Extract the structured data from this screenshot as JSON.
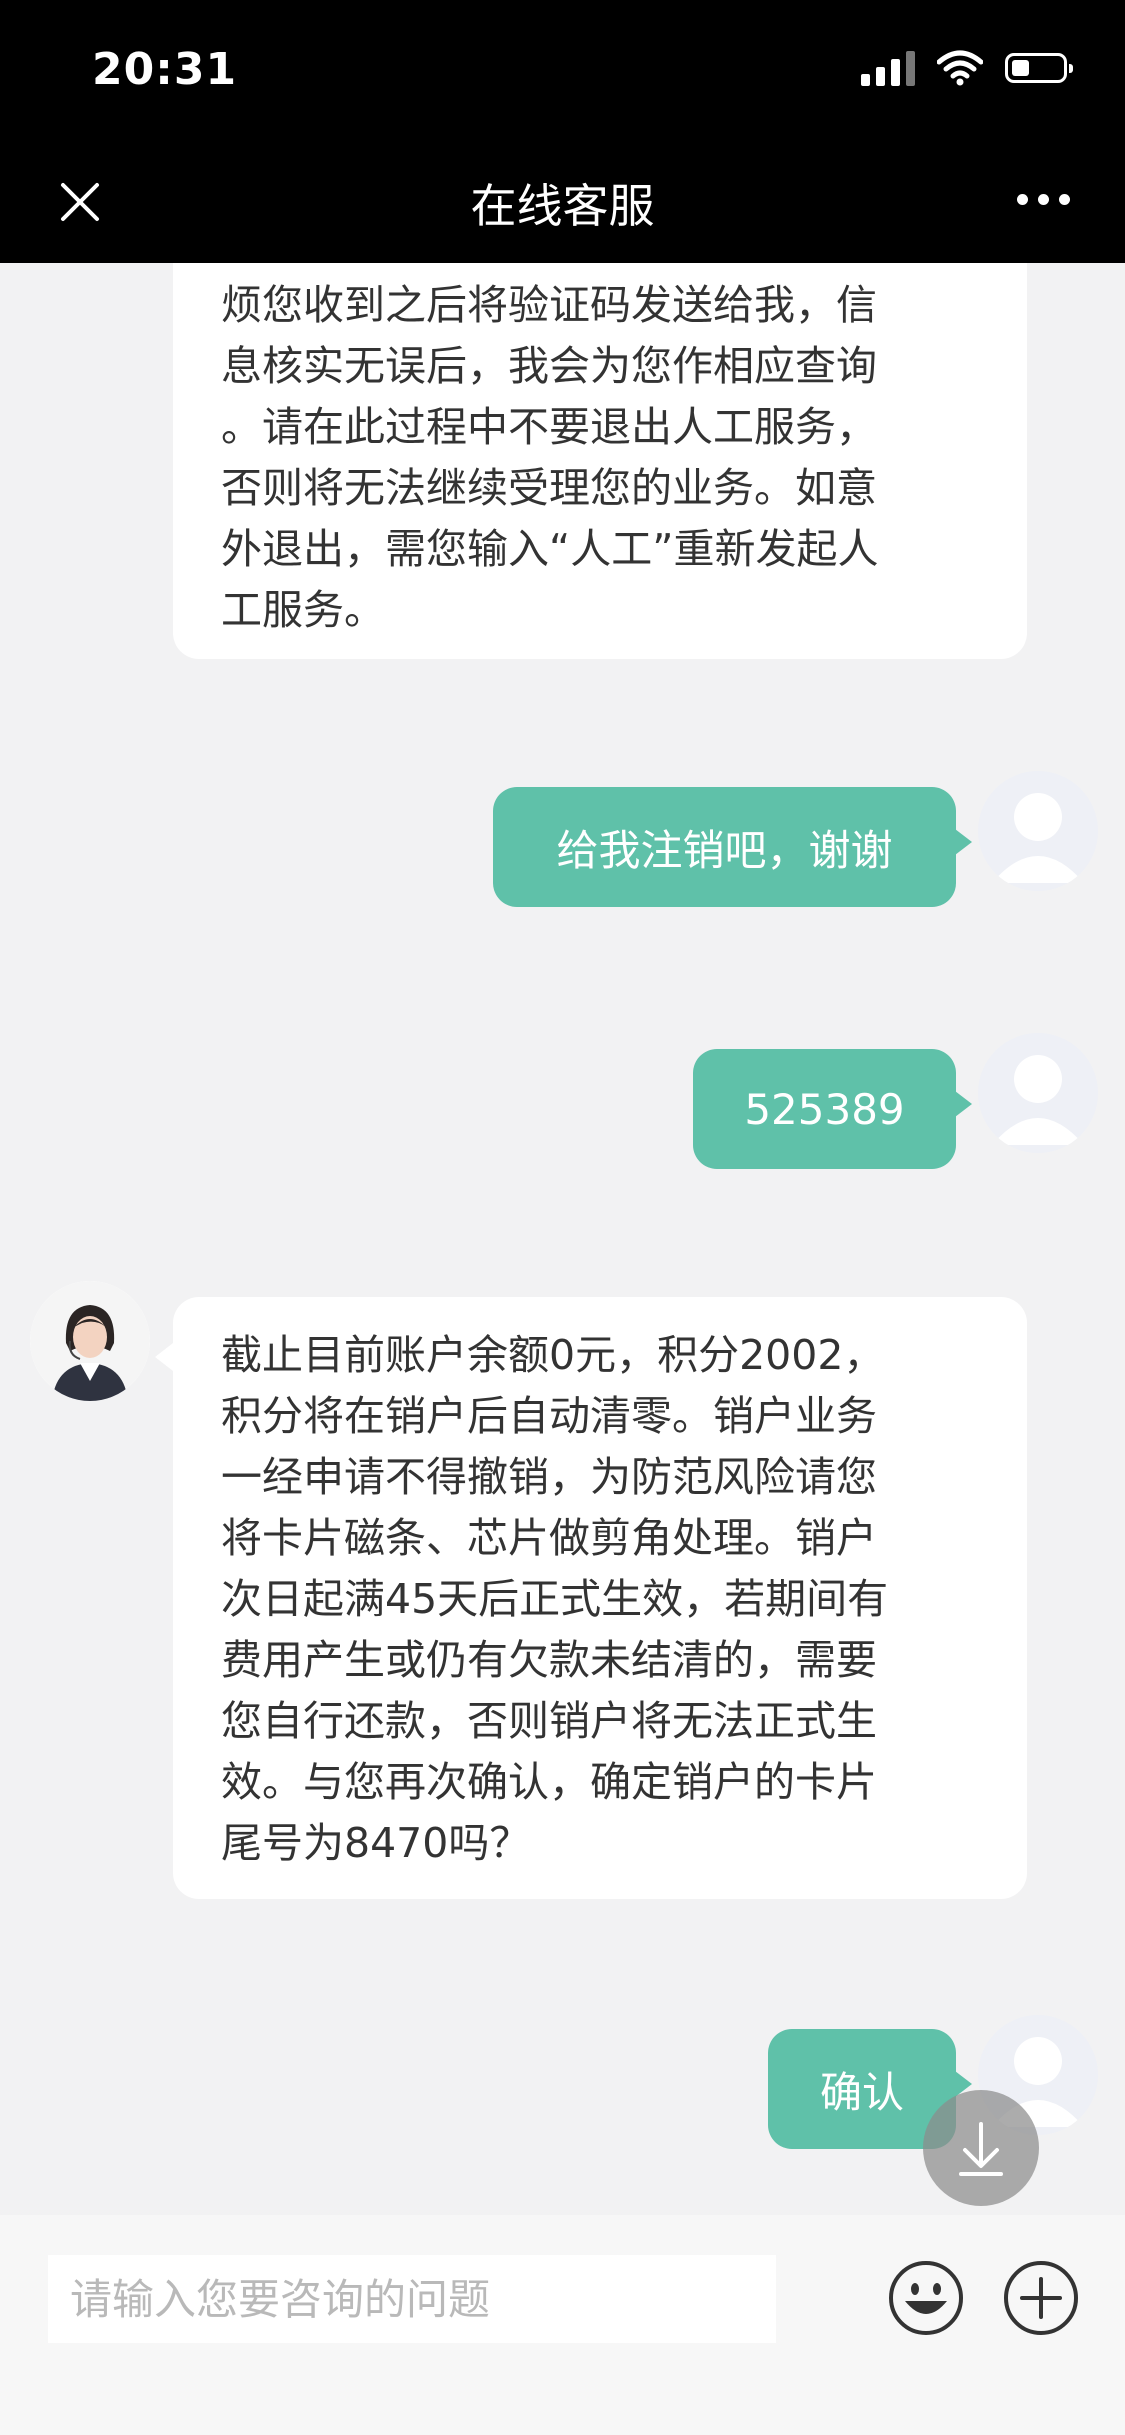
{
  "status_bar": {
    "time": "20:31",
    "icons": [
      "signal-icon",
      "wifi-icon",
      "battery-icon"
    ],
    "battery_level_fraction": 0.35
  },
  "nav": {
    "title": "在线客服",
    "close_icon": "close-icon",
    "more_icon": "more-icon"
  },
  "messages": [
    {
      "from": "agent",
      "text": "烦您收到之后将验证码发送给我，信\n息核实无误后，我会为您作相应查询\n。请在此过程中不要退出人工服务，\n否则将无法继续受理您的业务。如意\n外退出，需您输入“人工”重新发起人\n工服务。"
    },
    {
      "from": "user",
      "text": "给我注销吧，谢谢"
    },
    {
      "from": "user",
      "text": "525389"
    },
    {
      "from": "agent",
      "text": "截止目前账户余额0元，积分2002，\n积分将在销户后自动清零。销户业务\n一经申请不得撤销，为防范风险请您\n将卡片磁条、芯片做剪角处理。销户\n次日起满45天后正式生效，若期间有\n费用产生或仍有欠款未结清的，需要\n您自行还款，否则销户将无法正式生\n效。与您再次确认，确定销户的卡片\n尾号为8470吗？"
    },
    {
      "from": "user",
      "text": "确认"
    }
  ],
  "input": {
    "placeholder": "请输入您要咨询的问题",
    "value": ""
  },
  "colors": {
    "user_bubble": "#5fc1a9",
    "agent_bubble": "#ffffff",
    "background": "#f2f2f3",
    "header": "#000000"
  }
}
